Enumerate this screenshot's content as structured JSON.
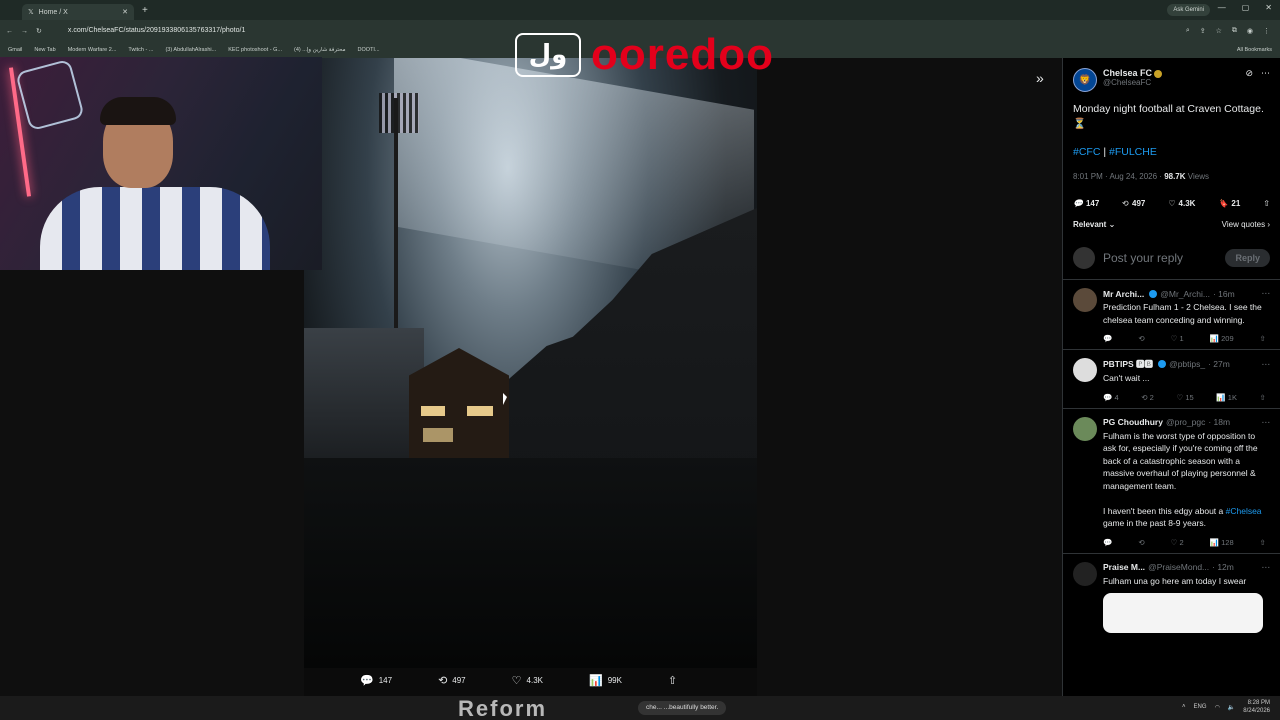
{
  "browser": {
    "tab_title": "Home / X",
    "url": "x.com/ChelseaFC/status/2091933806135763317/photo/1",
    "ask_gemini": "Ask Gemini",
    "bookmarks": [
      "Gmail",
      "New Tab",
      "Modern Warfare 2...",
      "Twitch - ...",
      "(3) AbdullahAlrashi...",
      "KEC photoshoot - G...",
      "محترفة شارين وإ... (4)",
      "DOOTI..."
    ],
    "all_bookmarks": "All Bookmarks"
  },
  "brand": {
    "arabic": "ول",
    "name": "ooredoo"
  },
  "photo_actions": {
    "replies": "147",
    "reposts": "497",
    "likes": "4.3K",
    "views": "99K"
  },
  "tweet": {
    "author_name": "Chelsea FC",
    "author_handle": "@ChelseaFC",
    "text": "Monday night football at Craven Cottage. ⏳",
    "hashtag1": "#CFC",
    "separator": "|",
    "hashtag2": "#FULCHE",
    "time": "8:01 PM · Aug 24, 2026 ·",
    "views": "98.7K",
    "views_label": "Views",
    "replies": "147",
    "reposts": "497",
    "likes": "4.3K",
    "bookmarks": "21",
    "relevant": "Relevant",
    "view_quotes": "View quotes",
    "reply_placeholder": "Post your reply",
    "reply_button": "Reply"
  },
  "replies": [
    {
      "name": "Mr Archi...",
      "handle": "@Mr_Archi...",
      "time": "· 16m",
      "text": "Prediction Fulham 1 - 2 Chelsea.  I see the chelsea team conceding and winning.",
      "replies": "",
      "reposts": "",
      "likes": "1",
      "views": "209"
    },
    {
      "name": "PBTIPS 🅿🅱",
      "handle": "@pbtips_",
      "time": "· 27m",
      "text": "Can't wait ...",
      "replies": "4",
      "reposts": "2",
      "likes": "15",
      "views": "1K"
    },
    {
      "name": "PG Choudhury",
      "handle": "@pro_pgc",
      "time": "· 18m",
      "text": "Fulham is the worst type of opposition to ask for, especially if you're coming off the back of a catastrophic season with a massive overhaul of playing personnel & management team.\n\nI haven't been this edgy about a",
      "tag": "#Chelsea",
      "text_after": " game in the past 8-9 years.",
      "replies": "",
      "reposts": "",
      "likes": "2",
      "views": "128"
    },
    {
      "name": "Praise M...",
      "handle": "@PraiseMond...",
      "time": "· 12m",
      "text": "Fulham una go here am today I swear"
    }
  ],
  "taskbar": {
    "overlay_text": "Reform",
    "search_text": "che... ...beautifully better.",
    "lang": "ENG",
    "time": "8:28 PM",
    "date": "8/24/2026"
  },
  "colors": {
    "accent_blue": "#1d9bf0",
    "ooredoo_red": "#e3001b",
    "chelsea_blue": "#034694"
  }
}
